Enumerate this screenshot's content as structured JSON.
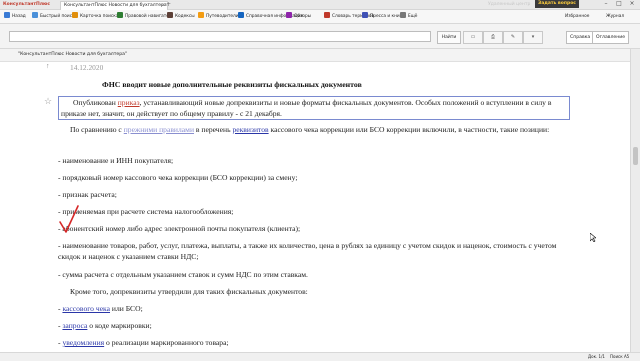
{
  "tabs": {
    "logo": "КонсультантПлюс",
    "doc_tab": "КонсультантПлюс Новости для бухгалтера",
    "support": "Удаленный центр",
    "save_label": "Задать вопрос"
  },
  "toolbar": [
    {
      "label": "Назад",
      "color": "#3a7bd5"
    },
    {
      "label": "Быстрый поиск",
      "color": "#4a90d9"
    },
    {
      "label": "Карточка поиска",
      "color": "#e08e0b"
    },
    {
      "label": "Правовой навигатор",
      "color": "#2e7d32"
    },
    {
      "label": "Кодексы",
      "color": "#5d4037"
    },
    {
      "label": "Путеводители",
      "color": "#f39c12"
    },
    {
      "label": "Справочная информация",
      "color": "#1565c0"
    },
    {
      "label": "Обзоры",
      "color": "#8e24aa"
    },
    {
      "label": "Словарь терминов",
      "color": "#c0392b"
    },
    {
      "label": "Пресса и книги",
      "color": "#3f51b5"
    },
    {
      "label": "Ещё",
      "color": "#777777"
    }
  ],
  "toolbar_right": {
    "favorites": "Избранное",
    "journal": "Журнал"
  },
  "search": {
    "value": "",
    "button": "Найти"
  },
  "right_buttons": {
    "help": "Справка",
    "contents": "Оглавление"
  },
  "doc": {
    "source": "\"КонсультантПлюс Новости для бухгалтера\"",
    "date": "14.12.2020",
    "title": "ФНС вводит новые дополнительные реквизиты фискальных документов",
    "p1_before": "Опубликован ",
    "p1_link": "приказ",
    "p1_after": ", устанавливающий новые допреквизиты и новые форматы фискальных документов. Особых положений о вступлении в силу в приказе нет, значит, он действует по общему правилу - с 21 декабря.",
    "p2_before": "По сравнению с ",
    "p2_link1": "прежними правилами",
    "p2_mid": " в перечень ",
    "p2_link2": "реквизитов",
    "p2_after": " кассового чека коррекции или БСО коррекции включили, в частности, такие позиции:",
    "items": [
      "- наименование и ИНН покупателя;",
      "- порядковый номер кассового чека коррекции (БСО коррекции) за смену;",
      "- признак расчета;",
      "- применяемая при расчете система налогообложения;",
      "- абонентский номер либо адрес электронной почты покупателя (клиента);",
      "- наименование товаров, работ, услуг, платежа, выплаты, а также их количество, цена в рублях за единицу с учетом скидок и наценок, стоимость с учетом скидок и наценок с указанием ставки НДС;",
      "- сумма расчета с отдельным указанием ставок и сумм НДС по этим ставкам."
    ],
    "p3": "Кроме того, допреквизиты утвердили для таких фискальных документов:",
    "links": [
      {
        "link": "кассового чека",
        "after": " или БСО;"
      },
      {
        "link": "запроса",
        "after": " о коде маркировки;"
      },
      {
        "link": "уведомления",
        "after": " о реализации маркированного товара;"
      }
    ]
  },
  "status": {
    "page": "Док. 1/1",
    "zoom": "Поиск А5"
  }
}
